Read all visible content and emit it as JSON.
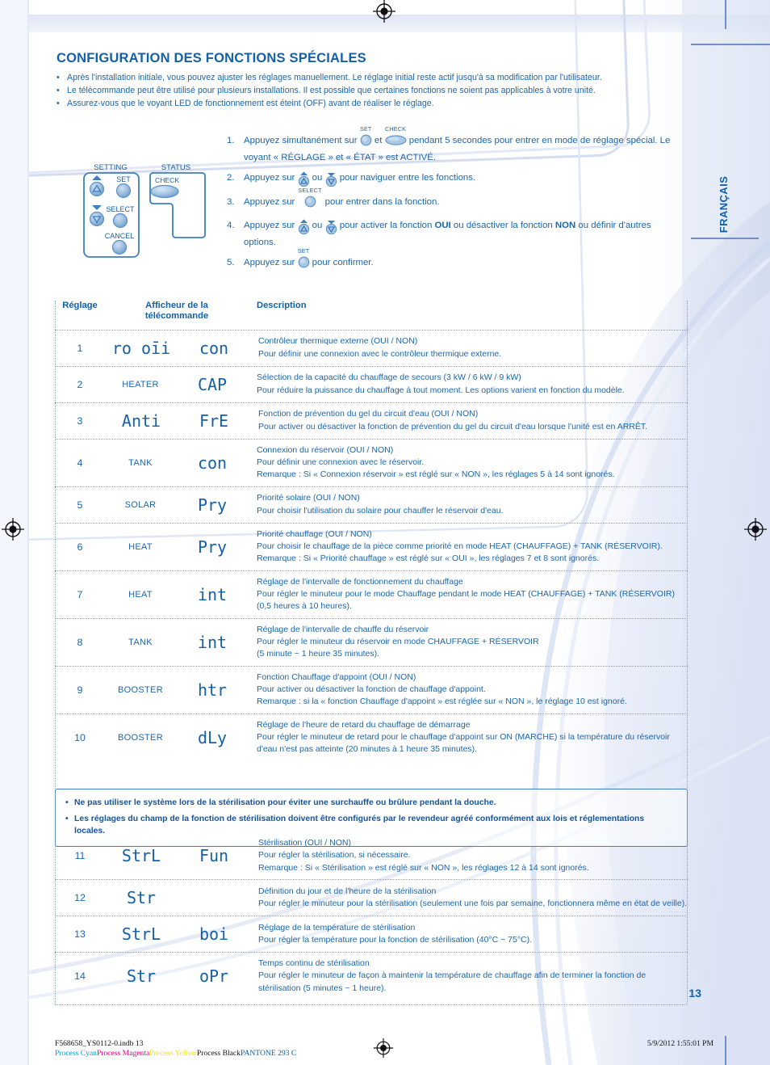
{
  "document": {
    "title": "CONFIGURATION DES FONCTIONS SPÉCIALES",
    "language_tab": "FRANÇAIS",
    "page_number": "13",
    "accent_color": "#1460a8",
    "text_color": "#1a66ad",
    "rule_color": "#7ea3cf"
  },
  "intro_bullets": [
    "Après l'installation initiale, vous pouvez ajuster les réglages manuellement. Le réglage initial reste actif jusqu'à sa modification par l'utilisateur.",
    "Le télécommande peut être utilisé pour plusieurs installations. Il est possible que certaines fonctions ne soient pas applicables à votre unité.",
    "Assurez-vous que le voyant LED de fonctionnement est éteint (OFF) avant de réaliser le réglage."
  ],
  "remote": {
    "setting_label": "SETTING",
    "status_label": "STATUS",
    "buttons": {
      "set": "SET",
      "select": "SELECT",
      "cancel": "CANCEL",
      "check": "CHECK"
    }
  },
  "steps": [
    {
      "num": "1.",
      "pre": "Appuyez simultanément sur",
      "btn1": "SET",
      "mid": "et",
      "btn2": "CHECK",
      "post": "pendant 5 secondes pour entrer en mode de réglage spécial. Le voyant « RÉGLAGE » et « ÉTAT » est ACTIVÉ."
    },
    {
      "num": "2.",
      "pre": "Appuyez sur",
      "mid": "ou",
      "post": "pour naviguer entre les fonctions."
    },
    {
      "num": "3.",
      "pre": "Appuyez sur",
      "btn1": "SELECT",
      "post": "pour entrer dans la fonction."
    },
    {
      "num": "4.",
      "pre": "Appuyez sur",
      "mid": "ou",
      "post_a": "pour activer la fonction",
      "bold_a": "OUI",
      "post_b": "ou désactiver la fonction",
      "bold_b": "NON",
      "post_c": "ou définir d'autres options."
    },
    {
      "num": "5.",
      "pre": "Appuyez sur",
      "btn1": "SET",
      "post": "pour confirmer."
    }
  ],
  "table": {
    "headers": {
      "setting": "Réglage",
      "display_line1": "Afficheur de la",
      "display_line2": "télécommande",
      "description": "Description"
    },
    "rows": [
      {
        "num": "1",
        "word": "",
        "lcd_a": "ro oīi",
        "lcd_b": "con",
        "desc": [
          "Contrôleur thermique externe (OUI / NON)",
          "Pour définir une connexion avec le contrôleur thermique externe."
        ]
      },
      {
        "num": "2",
        "word": "HEATER",
        "lcd_a": "",
        "lcd_b": "CAP",
        "desc": [
          "Sélection de la capacité du chauffage de secours (3 kW / 6 kW / 9 kW)",
          "Pour réduire la puissance du chauffage à tout moment. Les options varient en fonction du modèle."
        ]
      },
      {
        "num": "3",
        "word": "",
        "lcd_a": "Anti",
        "lcd_b": "FrE",
        "desc": [
          "Fonction de prévention du gel du circuit d'eau (OUI / NON)",
          "Pour activer ou désactiver la fonction de prévention du gel du circuit d'eau lorsque l'unité est en ARRÊT."
        ]
      },
      {
        "num": "4",
        "word": "TANK",
        "lcd_a": "",
        "lcd_b": "con",
        "desc": [
          "Connexion du réservoir (OUI / NON)",
          "Pour définir une connexion avec le réservoir.",
          "Remarque : Si « Connexion réservoir » est réglé sur « NON », les réglages 5 à 14 sont ignorés."
        ]
      },
      {
        "num": "5",
        "word": "SOLAR",
        "lcd_a": "",
        "lcd_b": "Pry",
        "desc": [
          "Priorité solaire (OUI / NON)",
          "Pour choisir l'utilisation du solaire pour chauffer le réservoir d'eau."
        ]
      },
      {
        "num": "6",
        "word": "HEAT",
        "lcd_a": "",
        "lcd_b": "Pry",
        "desc": [
          "Priorité chauffage (OUI / NON)",
          "Pour choisir le chauffage de la pièce comme priorité en mode HEAT (CHAUFFAGE) + TANK (RÉSERVOIR).",
          "Remarque : Si « Priorité chauffage » est réglé sur « OUI », les réglages 7 et 8 sont ignorés."
        ]
      },
      {
        "num": "7",
        "word": "HEAT",
        "lcd_a": "",
        "lcd_b": "int",
        "desc": [
          "Réglage de l'intervalle de fonctionnement du chauffage",
          "Pour régler le minuteur pour le mode Chauffage pendant le mode HEAT (CHAUFFAGE) + TANK (RÉSERVOIR) (0,5 heures à 10 heures)."
        ]
      },
      {
        "num": "8",
        "word": "TANK",
        "lcd_a": "",
        "lcd_b": "int",
        "desc": [
          "Réglage de l'intervalle de chauffe du réservoir",
          "Pour régler le minuteur du réservoir en mode CHAUFFAGE + RÉSERVOIR",
          "(5 minute ~ 1 heure 35 minutes)."
        ]
      },
      {
        "num": "9",
        "word": "BOOSTER",
        "lcd_a": "",
        "lcd_b": "htr",
        "desc": [
          "Fonction Chauffage d'appoint (OUI / NON)",
          "Pour activer ou désactiver la fonction de chauffage d'appoint.",
          "Remarque : si la « fonction Chauffage d'appoint » est réglée sur « NON », le réglage 10 est ignoré."
        ]
      },
      {
        "num": "10",
        "word": "BOOSTER",
        "lcd_a": "",
        "lcd_b": "dLy",
        "desc": [
          "Réglage de l'heure de retard du chauffage de démarrage",
          "Pour régler le minuteur de retard pour le chauffage d'appoint sur ON (MARCHE) si la température du réservoir d'eau n'est pas atteinte (20 minutes à 1 heure 35 minutes)."
        ]
      }
    ],
    "rows_sterilisation": [
      {
        "num": "11",
        "word": "",
        "lcd_a": "StrL",
        "lcd_b": "Fun",
        "desc": [
          "Stérilisation (OUI / NON)",
          "Pour régler la stérilisation, si nécessaire.",
          "Remarque : Si « Stérilisation » est réglé sur « NON », les réglages 12 à 14 sont ignorés."
        ]
      },
      {
        "num": "12",
        "word": "",
        "lcd_a": "Str",
        "lcd_b": "",
        "desc": [
          "Définition du jour et de l'heure de la stérilisation",
          "Pour régler le minuteur pour la stérilisation (seulement une fois par semaine, fonctionnera même en état de veille)."
        ]
      },
      {
        "num": "13",
        "word": "",
        "lcd_a": "StrL",
        "lcd_b": "boi",
        "desc": [
          "Réglage de la température de stérilisation",
          "Pour régler la température pour la fonction de stérilisation (40°C ~ 75°C)."
        ]
      },
      {
        "num": "14",
        "word": "",
        "lcd_a": "Str",
        "lcd_b": "oPr",
        "desc": [
          "Temps continu de stérilisation",
          "Pour régler le minuteur de façon à maintenir la température de chauffage afin de terminer la fonction de stérilisation (5 minutes ~ 1 heure)."
        ]
      }
    ]
  },
  "warning_box": {
    "bullets": [
      "Ne pas utiliser le système lors de la stérilisation pour éviter une surchauffe ou brûlure pendant la douche.",
      "Les réglages du champ de la fonction de stérilisation doivent être configurés par le revendeur agréé conformément aux lois et réglementations locales."
    ]
  },
  "footer": {
    "file": "F568658_YS0112-0.indb   13",
    "date": "5/9/2012   1:55:01 PM",
    "separators": [
      "Process Cyan",
      "Process Magenta",
      "Process Yellow",
      "Process Black",
      "PANTONE 293 C"
    ]
  }
}
